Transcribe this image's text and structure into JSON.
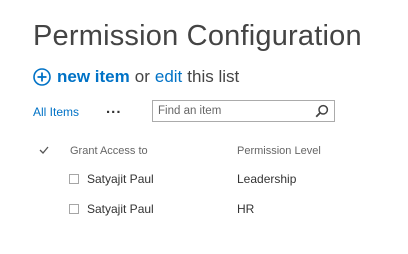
{
  "page": {
    "title": "Permission Configuration"
  },
  "actions": {
    "new_item_label": "new item",
    "or_text": "or",
    "edit_label": "edit",
    "this_list_text": "this list"
  },
  "toolbar": {
    "view_label": "All Items",
    "more_label": "...",
    "search_placeholder": "Find an item",
    "search_value": ""
  },
  "table": {
    "headers": {
      "grant_access_to": "Grant Access to",
      "permission_level": "Permission Level"
    },
    "rows": [
      {
        "grant_access_to": "Satyajit Paul",
        "permission_level": "Leadership"
      },
      {
        "grant_access_to": "Satyajit Paul",
        "permission_level": "HR"
      }
    ]
  },
  "colors": {
    "accent": "#0072c6",
    "text": "#444444",
    "muted": "#666666"
  },
  "icons": {
    "new_item": "plus-circle-icon",
    "search": "search-icon",
    "select_all": "checkmark-icon"
  }
}
